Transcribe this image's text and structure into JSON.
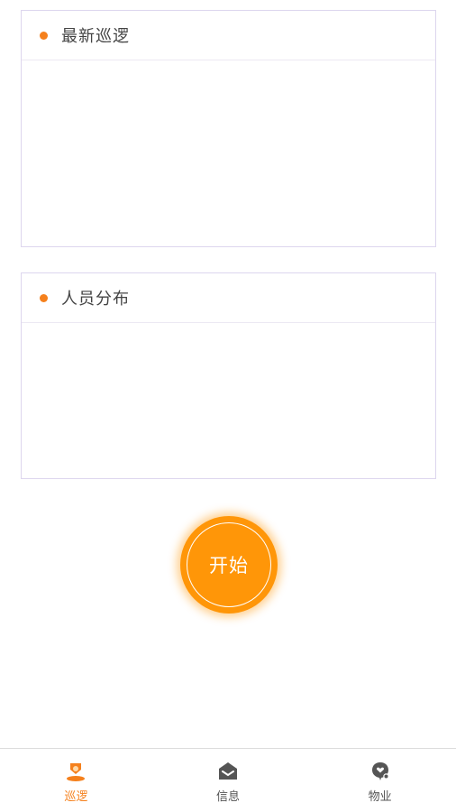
{
  "cards": [
    {
      "title": "最新巡逻"
    },
    {
      "title": "人员分布"
    }
  ],
  "start_button": {
    "label": "开始"
  },
  "tabbar": {
    "active_index": 0,
    "tabs": [
      {
        "label": "巡逻",
        "icon": "patrol-icon",
        "color": "#f5801c"
      },
      {
        "label": "信息",
        "icon": "message-icon",
        "color": "#555555"
      },
      {
        "label": "物业",
        "icon": "property-icon",
        "color": "#555555"
      }
    ]
  },
  "colors": {
    "accent": "#f5801c",
    "start_button": "#ff9608",
    "card_border": "#ddd6ee"
  }
}
